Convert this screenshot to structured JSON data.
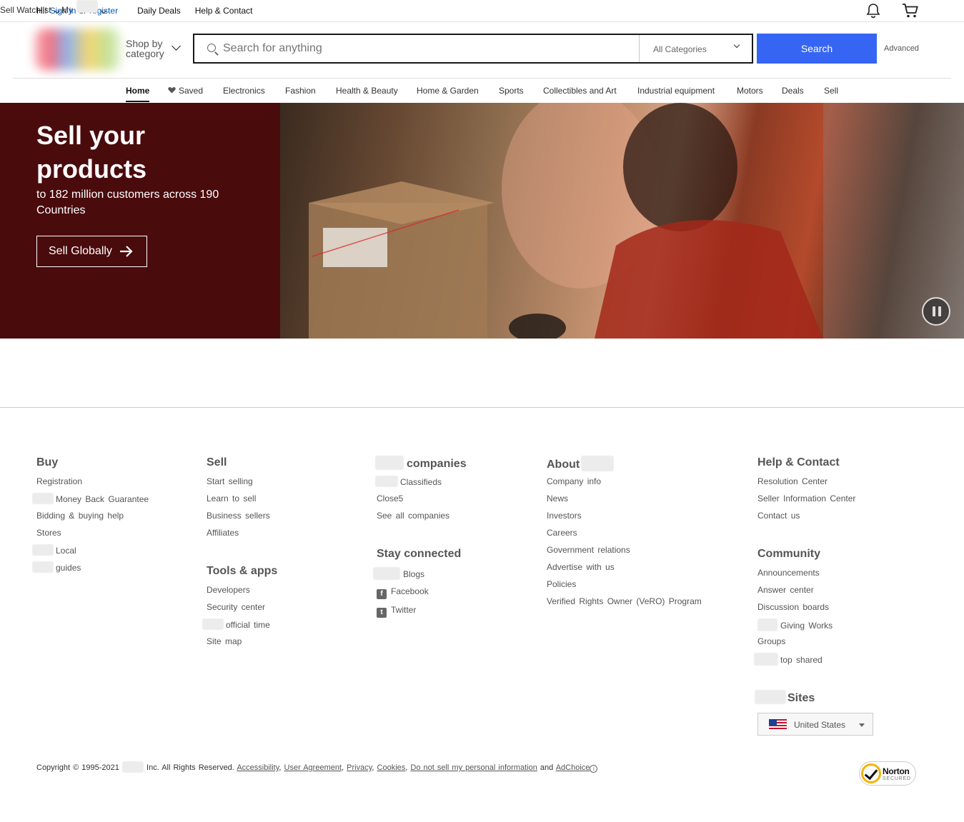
{
  "topbar": {
    "greeting": "Hi!",
    "sign_in": "Sign in",
    "or": "or",
    "register": "register",
    "daily_deals": "Daily Deals",
    "help_contact": "Help & Contact",
    "sell": "Sell",
    "watchlist": "Watchlist",
    "my": "My"
  },
  "header": {
    "shop_by_line1": "Shop by",
    "shop_by_line2": "category",
    "search_placeholder": "Search for anything",
    "category_select": "All Categories",
    "search_button": "Search",
    "advanced": "Advanced"
  },
  "nav": {
    "items": [
      "Home",
      "Saved",
      "Electronics",
      "Fashion",
      "Health & Beauty",
      "Home & Garden",
      "Sports",
      "Collectibles and Art",
      "Industrial equipment",
      "Motors",
      "Deals",
      "Sell"
    ]
  },
  "hero": {
    "title": "Sell your products",
    "subtitle": "to 182 million customers across 190 Countries",
    "cta": "Sell Globally"
  },
  "footer": {
    "buy": {
      "heading": "Buy",
      "links": [
        "Registration",
        "Money Back Guarantee",
        "Bidding & buying help",
        "Stores",
        "Local",
        "guides"
      ]
    },
    "sell": {
      "heading": "Sell",
      "links": [
        "Start selling",
        "Learn to sell",
        "Business sellers",
        "Affiliates"
      ]
    },
    "tools": {
      "heading": "Tools & apps",
      "links": [
        "Developers",
        "Security center",
        "official time",
        "Site map"
      ]
    },
    "companies": {
      "heading": "companies",
      "links": [
        "Classifieds",
        "Close5",
        "See all companies"
      ]
    },
    "stay_connected": {
      "heading": "Stay connected",
      "links": [
        "Blogs",
        "Facebook",
        "Twitter"
      ]
    },
    "about": {
      "heading": "About",
      "links": [
        "Company info",
        "News",
        "Investors",
        "Careers",
        "Government relations",
        "Advertise with us",
        "Policies",
        "Verified Rights Owner (VeRO) Program"
      ]
    },
    "help": {
      "heading": "Help & Contact",
      "links": [
        "Resolution Center",
        "Seller Information Center",
        "Contact us"
      ]
    },
    "community": {
      "heading": "Community",
      "links": [
        "Announcements",
        "Answer center",
        "Discussion boards",
        "Giving Works",
        "Groups",
        "top shared"
      ]
    },
    "sites": {
      "heading": "Sites",
      "selected": "United States"
    }
  },
  "legal": {
    "copyright": "Copyright © 1995-2021",
    "rights": "Inc. All Rights Reserved.",
    "accessibility": "Accessibility",
    "user_agreement": "User Agreement",
    "privacy": "Privacy",
    "cookies": "Cookies",
    "do_not_sell": "Do not sell my personal information",
    "and": "and",
    "adchoice": "AdChoice"
  },
  "badge": {
    "norton": "Norton",
    "secured": "SECURED"
  }
}
